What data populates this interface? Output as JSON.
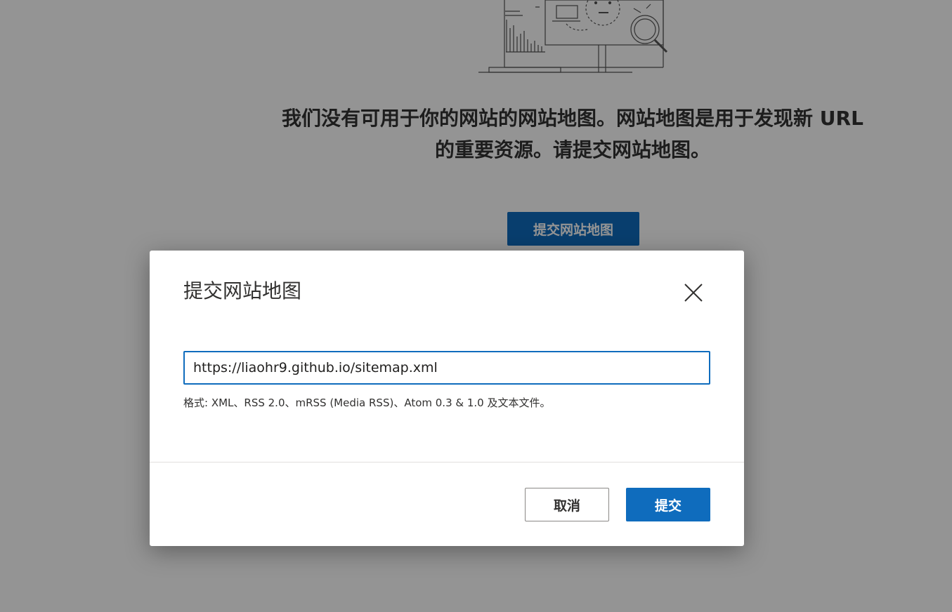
{
  "background": {
    "illustration_icon": "computer-monitor-analytics-illustration",
    "message": "我们没有可用于你的网站的网站地图。网站地图是用于发现新 URL 的重要资源。请提交网站地图。",
    "submit_button_label": "提交网站地图"
  },
  "dialog": {
    "title": "提交网站地图",
    "close_icon": "close-icon",
    "url_input_value": "https://liaohr9.github.io/sitemap.xml",
    "format_hint": "格式: XML、RSS 2.0、mRSS (Media RSS)、Atom 0.3 & 1.0 及文本文件。",
    "cancel_label": "取消",
    "submit_label": "提交"
  },
  "colors": {
    "primary": "#0f6cbd",
    "overlay": "rgba(0,0,0,0.42)",
    "text": "#323130"
  }
}
